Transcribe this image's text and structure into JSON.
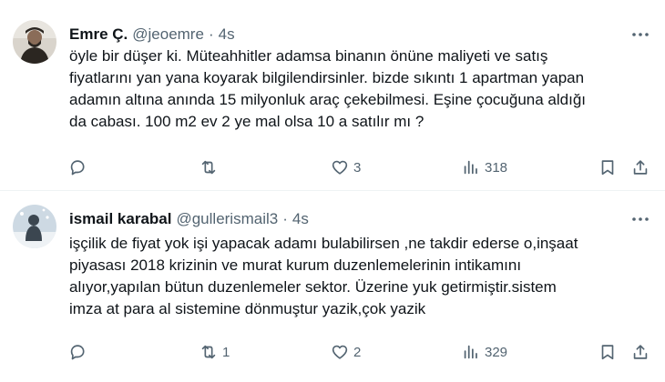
{
  "tweets": [
    {
      "name": "Emre Ç.",
      "handle": "@jeoemre",
      "separator": "·",
      "time": "4s",
      "text": "öyle bir düşer ki.  Müteahhitler adamsa binanın önüne maliyeti ve satış\nfiyatlarını yan yana koyarak bilgilendirsinler. bizde sıkıntı 1 apartman yapan\nadamın altına anında 15 milyonluk araç çekebilmesi. Eşine çocuğuna aldığı\nda cabası. 100 m2 ev 2 ye mal olsa 10 a satılır mı ?",
      "replies": "",
      "retweets": "",
      "likes": "3",
      "views": "318",
      "avatar_icon": "user-photo-avatar",
      "colors": {
        "avatar_bg": "#d9d4cc",
        "avatar_figure": "#2b2621"
      }
    },
    {
      "name": "ismail karabal",
      "handle": "@gullerismail3",
      "separator": "·",
      "time": "4s",
      "text": "işçilik de fiyat yok işi yapacak adamı bulabilirsen ,ne takdir ederse o,inşaat\npiyasası 2018 krizinin ve murat kurum duzenlemelerinin intikamını\nalıyor,yapılan bütun duzenlemeler sektor. Üzerine yuk getirmiştir.sistem\nimza at para al sistemine dönmuştur yazik,çok yazik",
      "replies": "",
      "retweets": "1",
      "likes": "2",
      "views": "329",
      "avatar_icon": "user-photo-avatar",
      "colors": {
        "avatar_bg": "#cdd9e3",
        "avatar_figure": "#3b4650"
      }
    }
  ],
  "icons": {
    "more": "more-dots-icon",
    "reply": "reply-bubble-icon",
    "retweet": "retweet-arrows-icon",
    "like": "heart-icon",
    "views": "views-bars-icon",
    "bookmark": "bookmark-icon",
    "share": "share-upload-icon"
  },
  "colors": {
    "text": "#0f1419",
    "muted": "#536471",
    "divider": "#eff3f4"
  }
}
